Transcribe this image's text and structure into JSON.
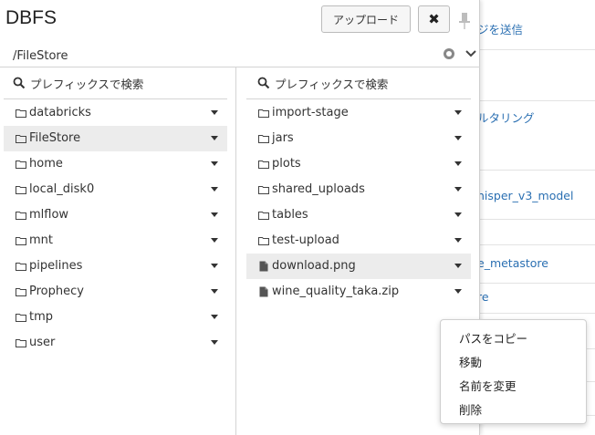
{
  "background": {
    "links": [
      "ジを送信",
      "ルタリング",
      "hisper_v3_model",
      "e_metastore",
      "re"
    ]
  },
  "modal": {
    "title": "DBFS",
    "upload_label": "アップロード",
    "close_symbol": "✖",
    "current_path": "/FileStore"
  },
  "left_column": {
    "search_placeholder": "プレフィックスで検索",
    "items": [
      {
        "label": "databricks",
        "type": "folder"
      },
      {
        "label": "FileStore",
        "type": "folder",
        "selected": true
      },
      {
        "label": "home",
        "type": "folder"
      },
      {
        "label": "local_disk0",
        "type": "folder"
      },
      {
        "label": "mlflow",
        "type": "folder"
      },
      {
        "label": "mnt",
        "type": "folder"
      },
      {
        "label": "pipelines",
        "type": "folder"
      },
      {
        "label": "Prophecy",
        "type": "folder"
      },
      {
        "label": "tmp",
        "type": "folder"
      },
      {
        "label": "user",
        "type": "folder"
      }
    ]
  },
  "right_column": {
    "search_placeholder": "プレフィックスで検索",
    "items": [
      {
        "label": "import-stage",
        "type": "folder"
      },
      {
        "label": "jars",
        "type": "folder"
      },
      {
        "label": "plots",
        "type": "folder"
      },
      {
        "label": "shared_uploads",
        "type": "folder"
      },
      {
        "label": "tables",
        "type": "folder"
      },
      {
        "label": "test-upload",
        "type": "folder"
      },
      {
        "label": "download.png",
        "type": "file",
        "selected": true
      },
      {
        "label": "wine_quality_taka.zip",
        "type": "file"
      }
    ]
  },
  "context_menu": {
    "items": [
      "パスをコピー",
      "移動",
      "名前を変更",
      "削除"
    ]
  }
}
